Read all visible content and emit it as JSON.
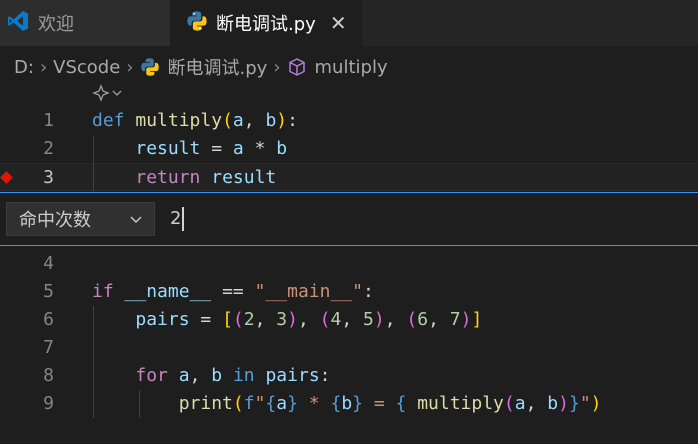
{
  "tabs": [
    {
      "label": "欢迎",
      "icon": "vscode-logo-icon"
    },
    {
      "label": "断电调试.py",
      "icon": "python-icon",
      "close": "✕"
    }
  ],
  "breadcrumb": {
    "items": [
      "D:",
      "VScode",
      "断电调试.py",
      "multiply"
    ],
    "separator": "›"
  },
  "editor": {
    "lines_top": [
      {
        "n": "1",
        "text": "def multiply(a, b):"
      },
      {
        "n": "2",
        "text": "    result = a * b"
      },
      {
        "n": "3",
        "text": "    return result"
      }
    ],
    "lines_bottom": [
      {
        "n": "4",
        "text": ""
      },
      {
        "n": "5",
        "text": "if __name__ == \"__main__\":"
      },
      {
        "n": "6",
        "text": "    pairs = [(2, 3), (4, 5), (6, 7)]"
      },
      {
        "n": "7",
        "text": ""
      },
      {
        "n": "8",
        "text": "    for a, b in pairs:"
      },
      {
        "n": "9",
        "text": "        print(f\"{a} * {b} = { multiply(a, b)}\")"
      }
    ],
    "breakpoint_line": "3"
  },
  "breakpoint_widget": {
    "type_selected": "命中次数",
    "value": "2"
  },
  "colors": {
    "accent": "#3794ff",
    "breakpoint": "#e51400",
    "background": "#1e1e1e"
  }
}
